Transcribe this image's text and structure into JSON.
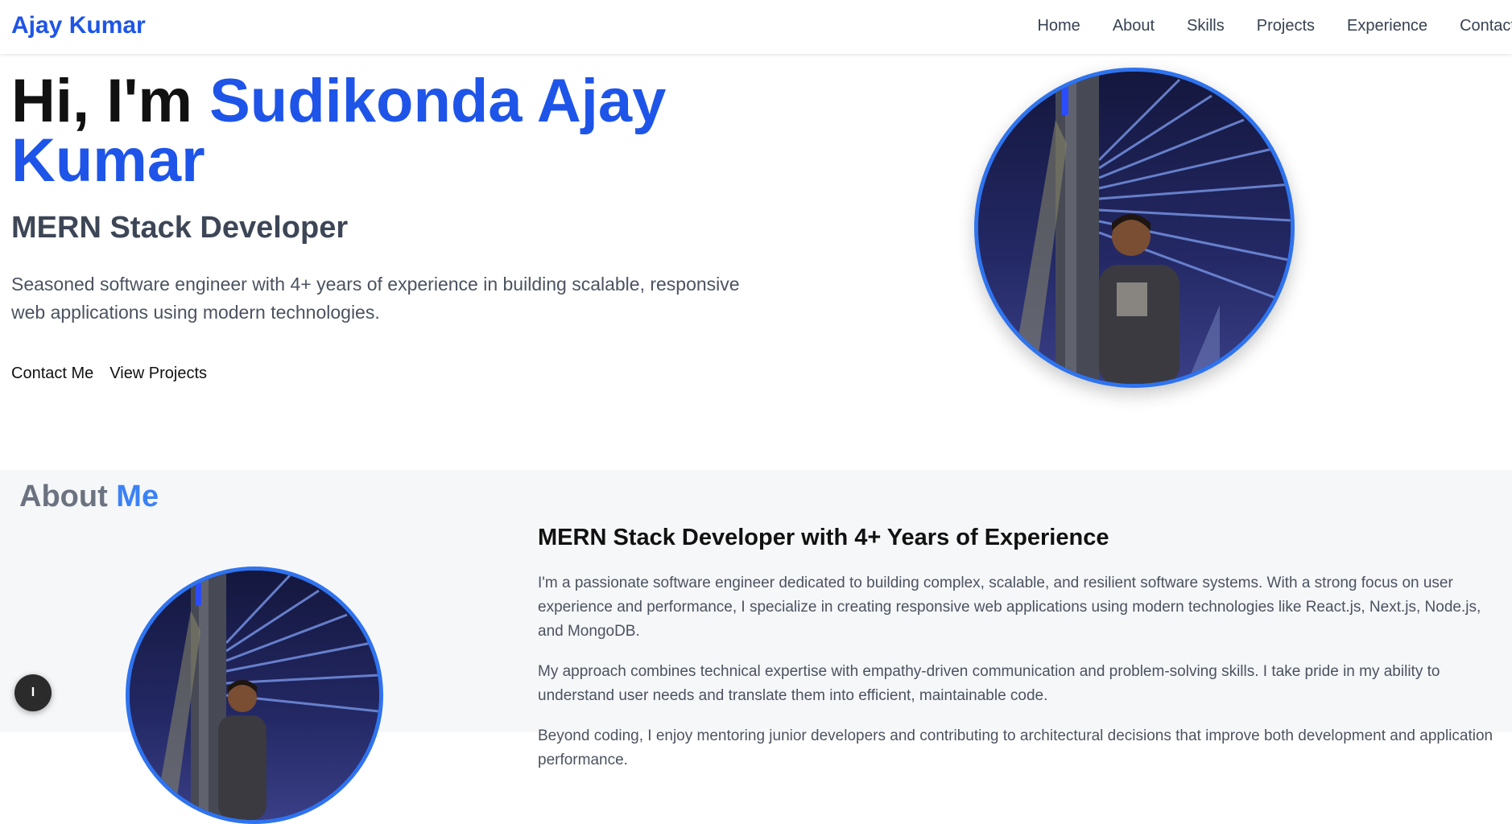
{
  "navbar": {
    "brand": "Ajay Kumar",
    "links": [
      "Home",
      "About",
      "Skills",
      "Projects",
      "Experience",
      "Contact"
    ]
  },
  "hero": {
    "greeting": "Hi, I'm ",
    "name": "Sudikonda Ajay Kumar",
    "role": "MERN Stack Developer",
    "intro": "Seasoned software engineer with 4+ years of experience in building scalable, responsive web applications using modern technologies.",
    "buttons": {
      "contact": "Contact Me",
      "projects": "View Projects"
    },
    "photo_icon": "profile-photo"
  },
  "about": {
    "title_part1": "About ",
    "title_part2": "Me",
    "subtitle": "MERN Stack Developer with 4+ Years of Experience",
    "paragraphs": [
      "I'm a passionate software engineer dedicated to building complex, scalable, and resilient software systems. With a strong focus on user experience and performance, I specialize in creating responsive web applications using modern technologies like React.js, Next.js, Node.js, and MongoDB.",
      "My approach combines technical expertise with empathy-driven communication and problem-solving skills. I take pride in my ability to understand user needs and translate them into efficient, maintainable code.",
      "Beyond coding, I enjoy mentoring junior developers and contributing to architectural decisions that improve both development and application performance."
    ]
  },
  "floating_button": {
    "label": "I"
  },
  "colors": {
    "accent": "#1e55e8",
    "accent_light": "#3b82f6",
    "photo_border": "#2f73ee",
    "section_bg": "#f6f7f9"
  }
}
